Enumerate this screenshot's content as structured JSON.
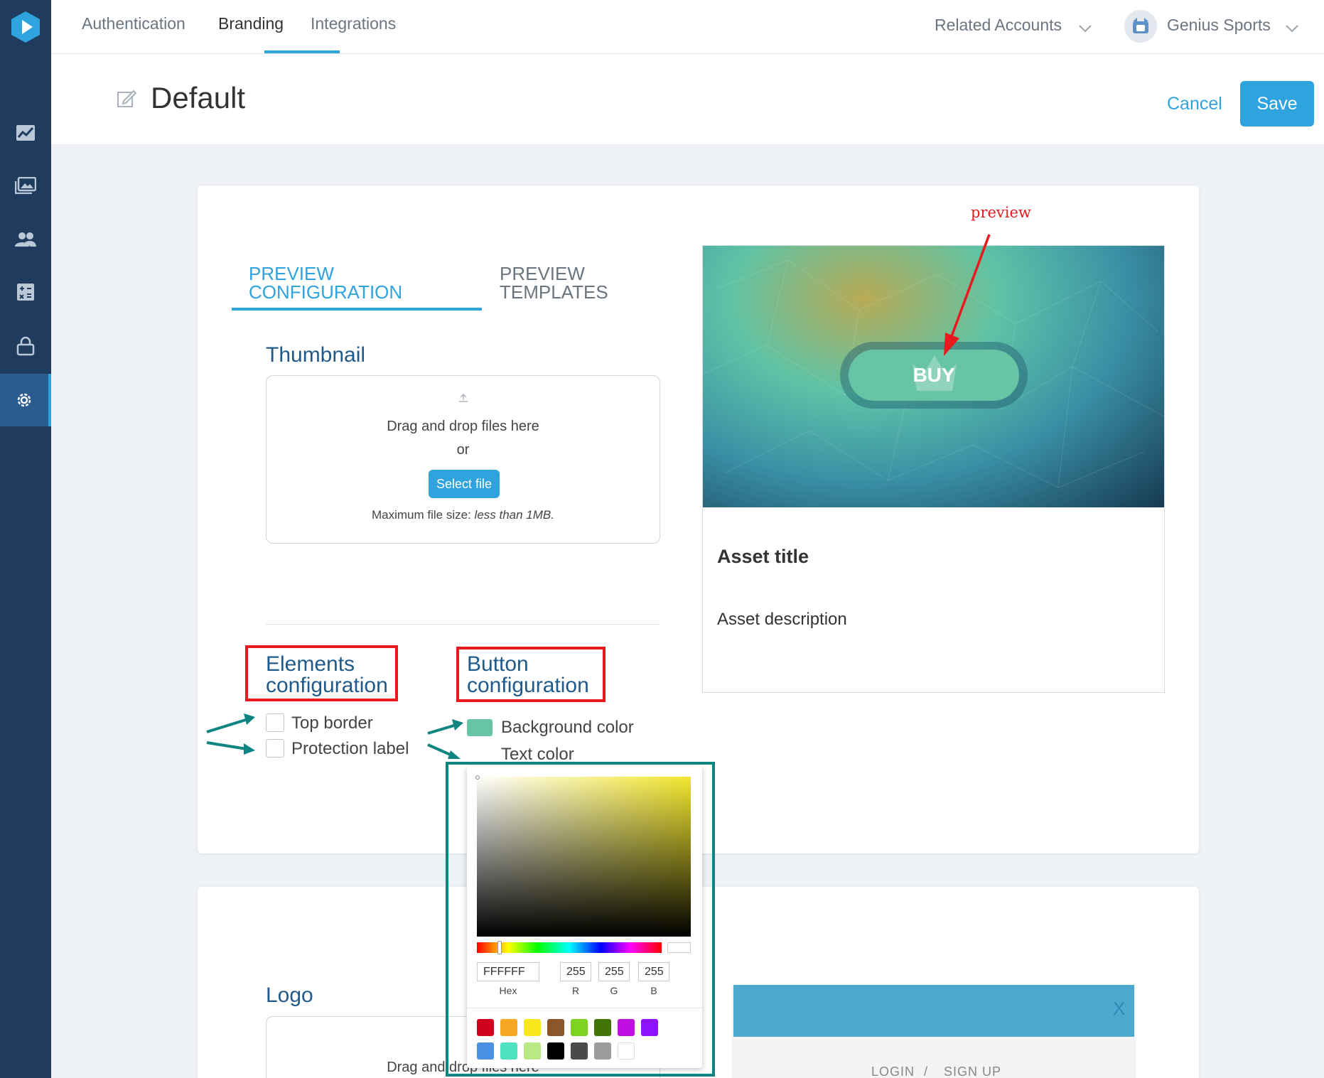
{
  "nav": {
    "tabs": [
      {
        "label": "Authentication"
      },
      {
        "label": "Branding"
      },
      {
        "label": "Integrations"
      }
    ],
    "related_accounts": "Related Accounts",
    "account_name": "Genius Sports"
  },
  "sidebar": {
    "items": [
      {
        "icon": "analytics-chart-icon"
      },
      {
        "icon": "media-gallery-icon"
      },
      {
        "icon": "users-icon"
      },
      {
        "icon": "calculator-icon"
      },
      {
        "icon": "lock-icon"
      },
      {
        "icon": "settings-gear-icon",
        "active": true
      }
    ]
  },
  "header": {
    "title": "Default",
    "cancel": "Cancel",
    "save": "Save"
  },
  "preview_tabs": {
    "configuration": "PREVIEW CONFIGURATION",
    "templates": "PREVIEW TEMPLATES"
  },
  "thumbnail": {
    "heading": "Thumbnail",
    "drop_text": "Drag and drop files here",
    "or": "or",
    "select_button": "Select file",
    "max_label": "Maximum file size:",
    "max_value": "less than 1MB."
  },
  "elements_config": {
    "heading": "Elements configuration",
    "top_border": "Top border",
    "protection_label": "Protection label"
  },
  "button_config": {
    "heading": "Button configuration",
    "background_color": "Background color",
    "text_color": "Text color",
    "background_swatch": "#67c4a5"
  },
  "preview": {
    "annotation": "preview",
    "buy_label": "BUY",
    "asset_title": "Asset title",
    "asset_description": "Asset description"
  },
  "color_picker": {
    "hex": "FFFFFF",
    "r": "255",
    "g": "255",
    "b": "255",
    "hex_label": "Hex",
    "r_label": "R",
    "g_label": "G",
    "b_label": "B",
    "hue_color": "#f2e62d",
    "swatches": [
      "#d0021b",
      "#f5a623",
      "#f8e71c",
      "#8b572a",
      "#7ed321",
      "#417505",
      "#bd10e0",
      "#9013fe",
      "#4a90e2",
      "#50e3c2",
      "#b8e986",
      "#000000",
      "#4a4a4a",
      "#9b9b9b",
      "#ffffff"
    ]
  },
  "logo": {
    "heading": "Logo",
    "drop_text": "Drag and drop files here"
  },
  "login_preview": {
    "login": "LOGIN",
    "separator": "/",
    "signup": "SIGN UP",
    "close": "X"
  }
}
